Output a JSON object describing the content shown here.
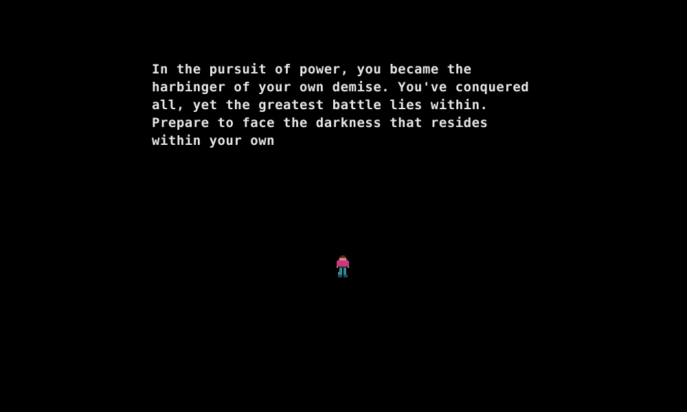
{
  "dialogue": {
    "lines": [
      "In the pursuit of power, you became the",
      "harbinger of your own demise. You've conquered",
      "all, yet the greatest battle lies within.",
      "Prepare to face the darkness that resides",
      "within your own"
    ]
  },
  "colors": {
    "background": "#000000",
    "text": "#e6e6e6",
    "player_shirt": "#c83a7a",
    "player_pants": "#2f8f8a",
    "player_skin": "#d9a07a"
  },
  "sprites": {
    "player": "player-character-sprite"
  }
}
